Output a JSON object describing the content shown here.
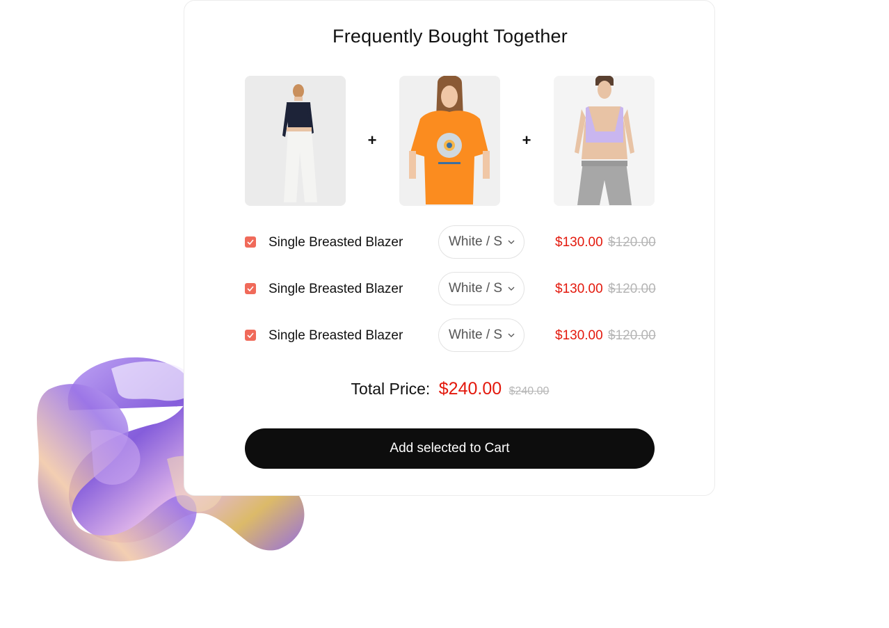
{
  "widget": {
    "title": "Frequently Bought Together",
    "plus_sign": "+",
    "accent_color": "#e3180c",
    "checkbox_color": "#f06a5a",
    "button_color": "#0d0d0d"
  },
  "products": [
    {
      "image_icon": "woman-navy-top-white-trousers",
      "name": "Single Breasted Blazer",
      "variant": "White / S",
      "price": "$130.00",
      "compare_price": "$120.00",
      "checked": true
    },
    {
      "image_icon": "woman-orange-graphic-tshirt",
      "name": "Single Breasted Blazer",
      "variant": "White / S",
      "price": "$130.00",
      "compare_price": "$120.00",
      "checked": true
    },
    {
      "image_icon": "woman-lilac-bra-grey-shorts",
      "name": "Single Breasted Blazer",
      "variant": "White / S",
      "price": "$130.00",
      "compare_price": "$120.00",
      "checked": true
    }
  ],
  "total": {
    "label": "Total Price:",
    "price": "$240.00",
    "compare_price": "$240.00"
  },
  "cart_button": {
    "label": "Add selected to Cart"
  }
}
